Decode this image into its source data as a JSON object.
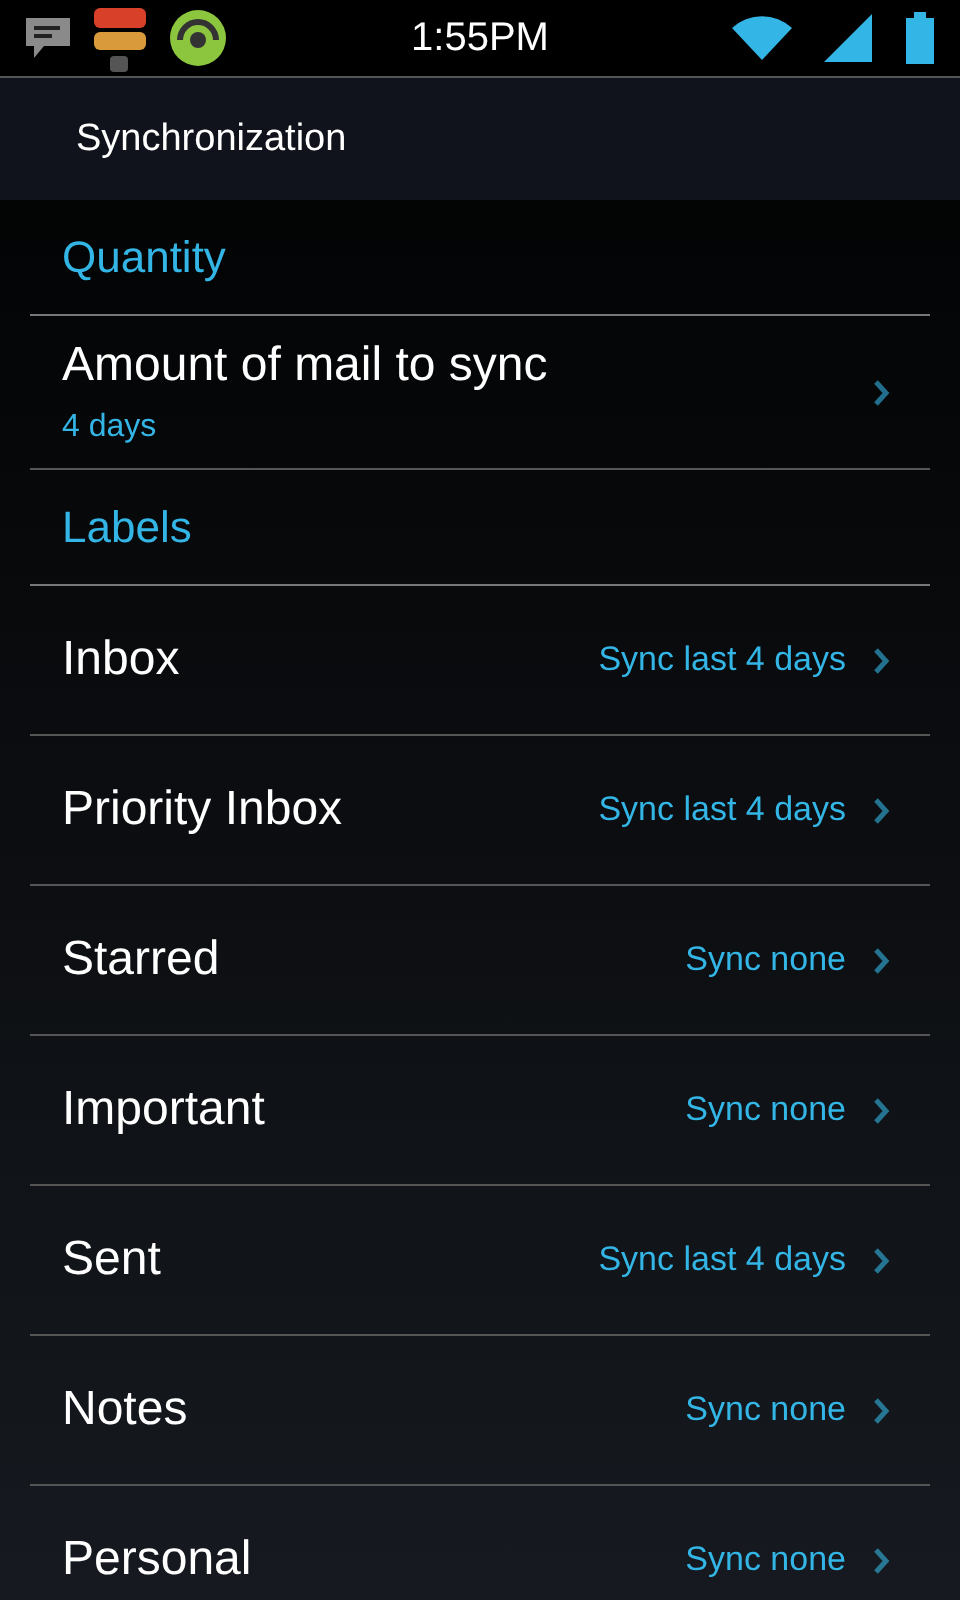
{
  "status_bar": {
    "time": "1:55PM"
  },
  "action_bar": {
    "title": "Synchronization"
  },
  "sections": [
    {
      "header": "Quantity",
      "items": [
        {
          "title": "Amount of mail to sync",
          "summary": "4 days"
        }
      ]
    },
    {
      "header": "Labels",
      "items": [
        {
          "title": "Inbox",
          "value": "Sync last 4 days"
        },
        {
          "title": "Priority Inbox",
          "value": "Sync last 4 days"
        },
        {
          "title": "Starred",
          "value": "Sync none"
        },
        {
          "title": "Important",
          "value": "Sync none"
        },
        {
          "title": "Sent",
          "value": "Sync last 4 days"
        },
        {
          "title": "Notes",
          "value": "Sync none"
        },
        {
          "title": "Personal",
          "value": "Sync none"
        }
      ]
    }
  ]
}
